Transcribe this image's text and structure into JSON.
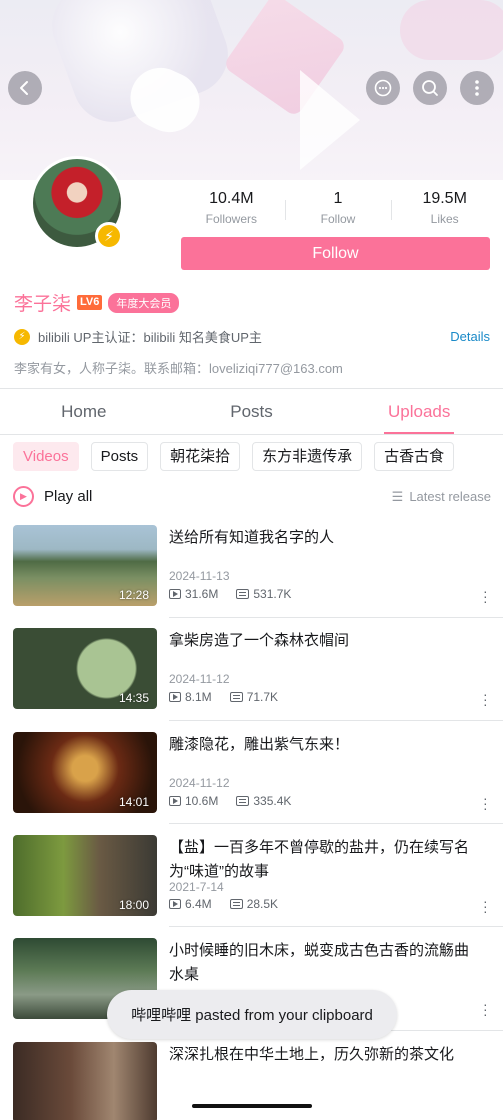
{
  "header": {
    "back_icon": "back-arrow-icon",
    "chat_icon": "chat-bubble-icon",
    "search_icon": "search-icon",
    "more_icon": "more-vertical-icon"
  },
  "profile": {
    "name": "李子柒",
    "level": "LV6",
    "vip_badge": "年度大会员",
    "stats": [
      {
        "value": "10.4M",
        "label": "Followers"
      },
      {
        "value": "1",
        "label": "Follow"
      },
      {
        "value": "19.5M",
        "label": "Likes"
      }
    ],
    "follow_label": "Follow",
    "certification": "bilibili UP主认证：bilibili 知名美食UP主",
    "details_label": "Details",
    "bio": "李家有女，人称子柒。联系邮箱：loveliziqi777@163.com"
  },
  "tabs": [
    {
      "label": "Home",
      "active": false
    },
    {
      "label": "Posts",
      "active": false
    },
    {
      "label": "Uploads",
      "active": true
    }
  ],
  "chips": [
    {
      "label": "Videos",
      "active": true
    },
    {
      "label": "Posts",
      "active": false
    },
    {
      "label": "朝花柒拾",
      "active": false
    },
    {
      "label": "东方非遗传承",
      "active": false
    },
    {
      "label": "古香古食",
      "active": false
    }
  ],
  "playall": {
    "label": "Play all",
    "sort_label": "Latest release"
  },
  "videos": [
    {
      "title": "送给所有知道我名字的人",
      "date": "2024-11-13",
      "views": "31.6M",
      "danmaku": "531.7K",
      "duration": "12:28"
    },
    {
      "title": "拿柴房造了一个森林衣帽间",
      "date": "2024-11-12",
      "views": "8.1M",
      "danmaku": "71.7K",
      "duration": "14:35"
    },
    {
      "title": "雕漆隐花，雕出紫气东来！",
      "date": "2024-11-12",
      "views": "10.6M",
      "danmaku": "335.4K",
      "duration": "14:01"
    },
    {
      "title": "【盐】一百多年不曾停歇的盐井，仍在续写名为“味道”的故事",
      "date": "2021-7-14",
      "views": "6.4M",
      "danmaku": "28.5K",
      "duration": "18:00"
    },
    {
      "title": "小时候睡的旧木床，蜕变成古色古香的流觞曲水桌",
      "date": "",
      "views": "",
      "danmaku": "",
      "duration": ""
    },
    {
      "title": "深深扎根在中华土地上，历久弥新的茶文化",
      "date": "",
      "views": "",
      "danmaku": "",
      "duration": ""
    }
  ],
  "toast": "哔哩哔哩 pasted from your clipboard",
  "colors": {
    "accent": "#fb7299",
    "link": "#1a8ac8",
    "badge": "#f6b800"
  }
}
